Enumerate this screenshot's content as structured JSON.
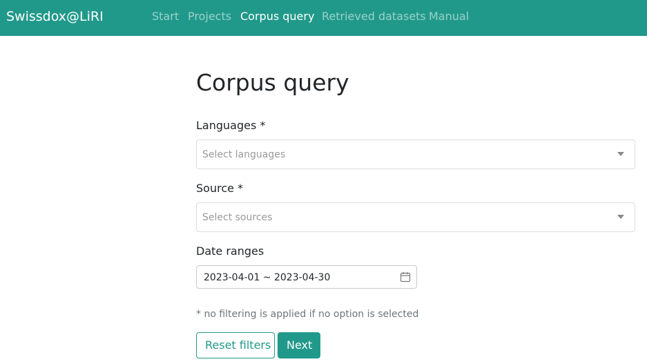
{
  "navbar": {
    "brand": "Swissdox@LiRI",
    "links": [
      {
        "label": "Start",
        "active": false
      },
      {
        "label": "Projects",
        "active": false
      },
      {
        "label": "Corpus query",
        "active": true
      },
      {
        "label": "Retrieved datasets",
        "active": false
      },
      {
        "label": "Manual",
        "active": false
      }
    ]
  },
  "main": {
    "title": "Corpus query",
    "languages": {
      "label": "Languages *",
      "placeholder": "Select languages",
      "icon": "chevron-down-icon"
    },
    "source": {
      "label": "Source *",
      "placeholder": "Select sources",
      "icon": "chevron-down-icon"
    },
    "date_ranges": {
      "label": "Date ranges",
      "value": "2023-04-01 ~ 2023-04-30",
      "icon": "calendar-icon"
    },
    "hint": "* no filtering is applied if no option is selected",
    "buttons": {
      "reset": "Reset filters",
      "next": "Next"
    }
  },
  "colors": {
    "brand": "#21998a",
    "text": "#212529",
    "muted": "#6c757d"
  }
}
